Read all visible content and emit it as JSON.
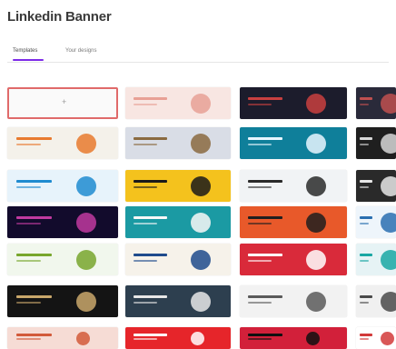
{
  "page": {
    "title": "Linkedin Banner"
  },
  "tabs": [
    {
      "label": "Templates",
      "active": true
    },
    {
      "label": "Your designs",
      "active": false
    }
  ],
  "blank": {
    "label": "+"
  },
  "cards": [
    {
      "col": 1,
      "row": 0,
      "bg": "#f8e6e2",
      "accent": "#e8a095",
      "label": ""
    },
    {
      "col": 2,
      "row": 0,
      "bg": "#1c1c2c",
      "accent": "#c94040",
      "label": ""
    },
    {
      "col": 3,
      "row": 0,
      "bg": "#2a2a3a",
      "accent": "#c05050",
      "label": ""
    },
    {
      "col": 0,
      "row": 1,
      "bg": "#f4f1ea",
      "accent": "#e87a2e",
      "label": ""
    },
    {
      "col": 1,
      "row": 1,
      "bg": "#d9dde6",
      "accent": "#8a6a40",
      "label": ""
    },
    {
      "col": 2,
      "row": 1,
      "bg": "#0f7f9a",
      "accent": "#e9f6ff",
      "label": ""
    },
    {
      "col": 3,
      "row": 1,
      "bg": "#1f1f1f",
      "accent": "#d8d8d8",
      "label": ""
    },
    {
      "col": 0,
      "row": 2,
      "bg": "#e7f3fb",
      "accent": "#1f8bd0",
      "label": ""
    },
    {
      "col": 1,
      "row": 2,
      "bg": "#f4c21d",
      "accent": "#1a1a1a",
      "label": ""
    },
    {
      "col": 2,
      "row": 2,
      "bg": "#f1f3f5",
      "accent": "#2a2a2a",
      "label": ""
    },
    {
      "col": 3,
      "row": 2,
      "bg": "#2a2a2a",
      "accent": "#e8e8e8",
      "label": ""
    },
    {
      "col": 0,
      "row": 3,
      "bg": "#120b2c",
      "accent": "#c13aa0",
      "label": ""
    },
    {
      "col": 1,
      "row": 3,
      "bg": "#1b9aa3",
      "accent": "#f8f8f8",
      "label": ""
    },
    {
      "col": 2,
      "row": 3,
      "bg": "#e8592a",
      "accent": "#1f1f1f",
      "label": ""
    },
    {
      "col": 3,
      "row": 3,
      "bg": "#eef5fb",
      "accent": "#2a6fb0",
      "label": ""
    },
    {
      "col": 0,
      "row": 4,
      "bg": "#f1f7ed",
      "accent": "#78a62d",
      "label": ""
    },
    {
      "col": 1,
      "row": 4,
      "bg": "#f6f2ea",
      "accent": "#1f4b8c",
      "label": ""
    },
    {
      "col": 2,
      "row": 4,
      "bg": "#d92a3a",
      "accent": "#ffffff",
      "label": ""
    },
    {
      "col": 3,
      "row": 4,
      "bg": "#e6f3f5",
      "accent": "#19a7a3",
      "label": ""
    },
    {
      "col": 0,
      "row": 5,
      "bg": "#141414",
      "accent": "#c9a76b",
      "label": ""
    },
    {
      "col": 1,
      "row": 5,
      "bg": "#2d3f4f",
      "accent": "#e7e7e7",
      "label": ""
    },
    {
      "col": 2,
      "row": 5,
      "bg": "#f2f2f2",
      "accent": "#5a5a5a",
      "label": ""
    },
    {
      "col": 3,
      "row": 5,
      "bg": "#f0f0f0",
      "accent": "#4a4a4a",
      "label": ""
    },
    {
      "col": 0,
      "row": 6,
      "bg": "#f6dcd5",
      "accent": "#d25a3a",
      "label": ""
    },
    {
      "col": 1,
      "row": 6,
      "bg": "#e6252a",
      "accent": "#ffffff",
      "label": ""
    },
    {
      "col": 2,
      "row": 6,
      "bg": "#d2203a",
      "accent": "#101010",
      "label": ""
    },
    {
      "col": 3,
      "row": 6,
      "bg": "#ffffff",
      "accent": "#d23a3a",
      "label": ""
    }
  ]
}
